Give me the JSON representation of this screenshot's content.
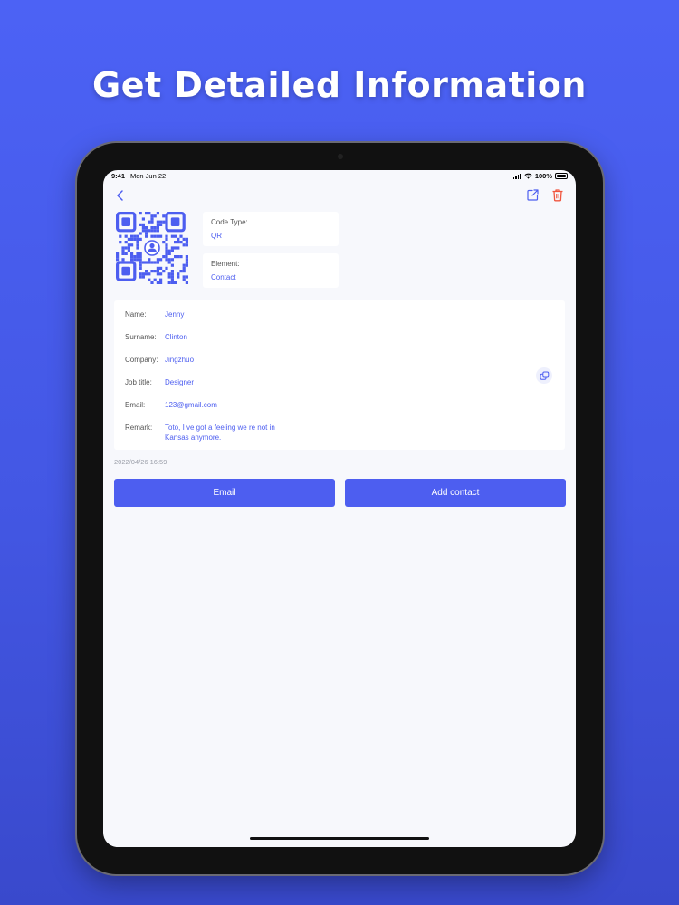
{
  "headline": "Get Detailed Information",
  "status_bar": {
    "time": "9:41",
    "date": "Mon Jun 22",
    "battery": "100%"
  },
  "nav": {
    "back_icon": "chevron-left-icon",
    "share_icon": "share-icon",
    "delete_icon": "trash-icon"
  },
  "code": {
    "type_label": "Code Type:",
    "type_value": "QR",
    "element_label": "Element:",
    "element_value": "Contact"
  },
  "contact": {
    "name_label": "Name:",
    "name": "Jenny",
    "surname_label": "Surname:",
    "surname": "Clinton",
    "company_label": "Company:",
    "company": "Jingzhuo",
    "job_label": "Job title:",
    "job": "Designer",
    "email_label": "Email:",
    "email": "123@gmail.com",
    "remark_label": "Remark:",
    "remark_line1": "Toto,  I ve got a feeling we re not in",
    "remark_line2": "Kansas anymore."
  },
  "timestamp": "2022/04/26 16:59",
  "actions": {
    "email": "Email",
    "add_contact": "Add contact"
  },
  "colors": {
    "accent": "#4d5ef0",
    "delete": "#f0553e",
    "background": "#4c62f5"
  }
}
